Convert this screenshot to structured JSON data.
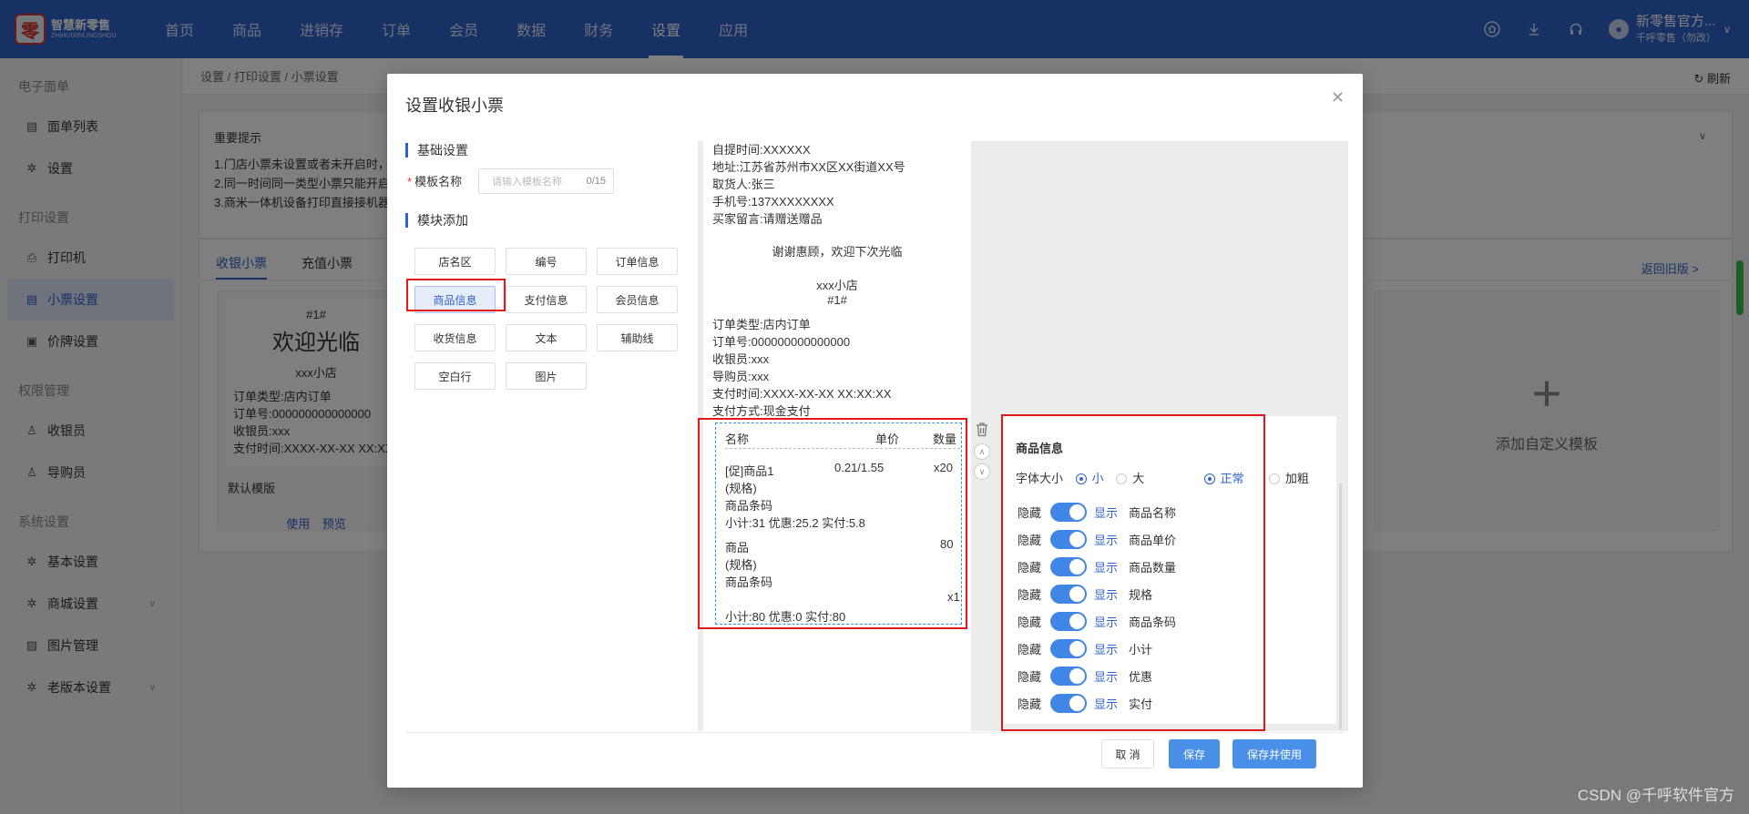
{
  "app": {
    "logo_mark": "零",
    "logo_name": "智慧新零售",
    "logo_sub": "ZHIHUIXINLINGSHOU",
    "nav": [
      "首页",
      "商品",
      "进销存",
      "订单",
      "会员",
      "数据",
      "财务",
      "设置",
      "应用"
    ],
    "active_nav": "设置",
    "user_name": "新零售官方...",
    "user_sub": "千呼零售（勿改）",
    "accent_color": "#2e62c8"
  },
  "sidebar": {
    "groups": [
      {
        "title": "电子面单",
        "items": [
          {
            "label": "面单列表",
            "icon": "document-icon"
          },
          {
            "label": "设置",
            "icon": "gear-icon"
          }
        ]
      },
      {
        "title": "打印设置",
        "items": [
          {
            "label": "打印机",
            "icon": "printer-icon"
          },
          {
            "label": "小票设置",
            "icon": "receipt-icon",
            "active": true
          },
          {
            "label": "价牌设置",
            "icon": "price-tag-icon"
          }
        ]
      },
      {
        "title": "权限管理",
        "items": [
          {
            "label": "收银员",
            "icon": "user-icon"
          },
          {
            "label": "导购员",
            "icon": "user-icon"
          }
        ]
      },
      {
        "title": "系统设置",
        "items": [
          {
            "label": "基本设置",
            "icon": "gear-icon"
          },
          {
            "label": "商城设置",
            "icon": "gear-icon",
            "expand": true
          },
          {
            "label": "图片管理",
            "icon": "image-icon"
          },
          {
            "label": "老版本设置",
            "icon": "gear-icon",
            "expand": true
          }
        ]
      }
    ]
  },
  "page": {
    "breadcrumb": "设置 / 打印设置 / 小票设置",
    "refresh_label": "刷新",
    "tip_title": "重要提示",
    "tips": [
      "1.门店小票未设置或者未开启时，",
      "2.同一时间同一类型小票只能开启",
      "3.商米一体机设备打印直接接机器"
    ],
    "tabs": [
      "收银小票",
      "充值小票"
    ],
    "back_old": "返回旧版 >",
    "template_card": {
      "line1": "#1#",
      "line2": "欢迎光临",
      "line3": "xxx小店",
      "lines": [
        "订单类型:店内订单",
        "订单号:000000000000000",
        "收银员:xxx",
        "支付时间:XXXX-XX-XX XX:XX:XX"
      ],
      "default_label": "默认模版",
      "actions": "使用 预览"
    },
    "add_template": "添加自定义模板",
    "watermark": "CSDN @千呼软件官方"
  },
  "modal": {
    "title": "设置收银小票",
    "basic_title": "基础设置",
    "name_label": "模板名称",
    "name_placeholder": "请输入模板名称",
    "name_count": "0/15",
    "module_title": "模块添加",
    "modules": [
      "店名区",
      "编号",
      "订单信息",
      "商品信息",
      "支付信息",
      "会员信息",
      "收货信息",
      "文本",
      "辅助线",
      "空白行",
      "图片"
    ],
    "active_module": "商品信息",
    "receipt": {
      "top_lines": [
        "自提时间:XXXXXX",
        "地址:江苏省苏州市XX区XX街道XX号",
        "取货人:张三",
        "手机号:137XXXXXXXX",
        "买家留言:请赠送赠品"
      ],
      "thanks": "谢谢惠顾，欢迎下次光临",
      "shop": "xxx小店",
      "number": "#1#",
      "order_lines": [
        "订单类型:店内订单",
        "订单号:000000000000000",
        "收银员:xxx",
        "导购员:xxx",
        "支付时间:XXXX-XX-XX XX:XX:XX",
        "支付方式:现金支付"
      ],
      "goods_headers": [
        "名称",
        "单价",
        "数量"
      ],
      "item1": {
        "name": "[促]商品1",
        "spec": "(规格)",
        "code": "商品条码",
        "price": "0.21/1.55",
        "qty": "x20",
        "summary": "小计:31   优惠:25.2   实付:5.8"
      },
      "item2": {
        "name": "商品",
        "spec": "(规格)",
        "code": "商品条码",
        "price": "80",
        "qty": "x1",
        "summary": "小计:80   优惠:0   实付:80"
      }
    },
    "settings": {
      "title": "商品信息",
      "font_size_label": "字体大小",
      "size_options": [
        "小",
        "大"
      ],
      "weight_options": [
        "正常",
        "加粗"
      ],
      "hide_label": "隐藏",
      "show_label": "显示",
      "fields": [
        "商品名称",
        "商品单价",
        "商品数量",
        "规格",
        "商品条码",
        "小计",
        "优惠",
        "实付"
      ]
    },
    "buttons": {
      "cancel": "取 消",
      "save": "保存",
      "save_use": "保存并使用"
    }
  }
}
